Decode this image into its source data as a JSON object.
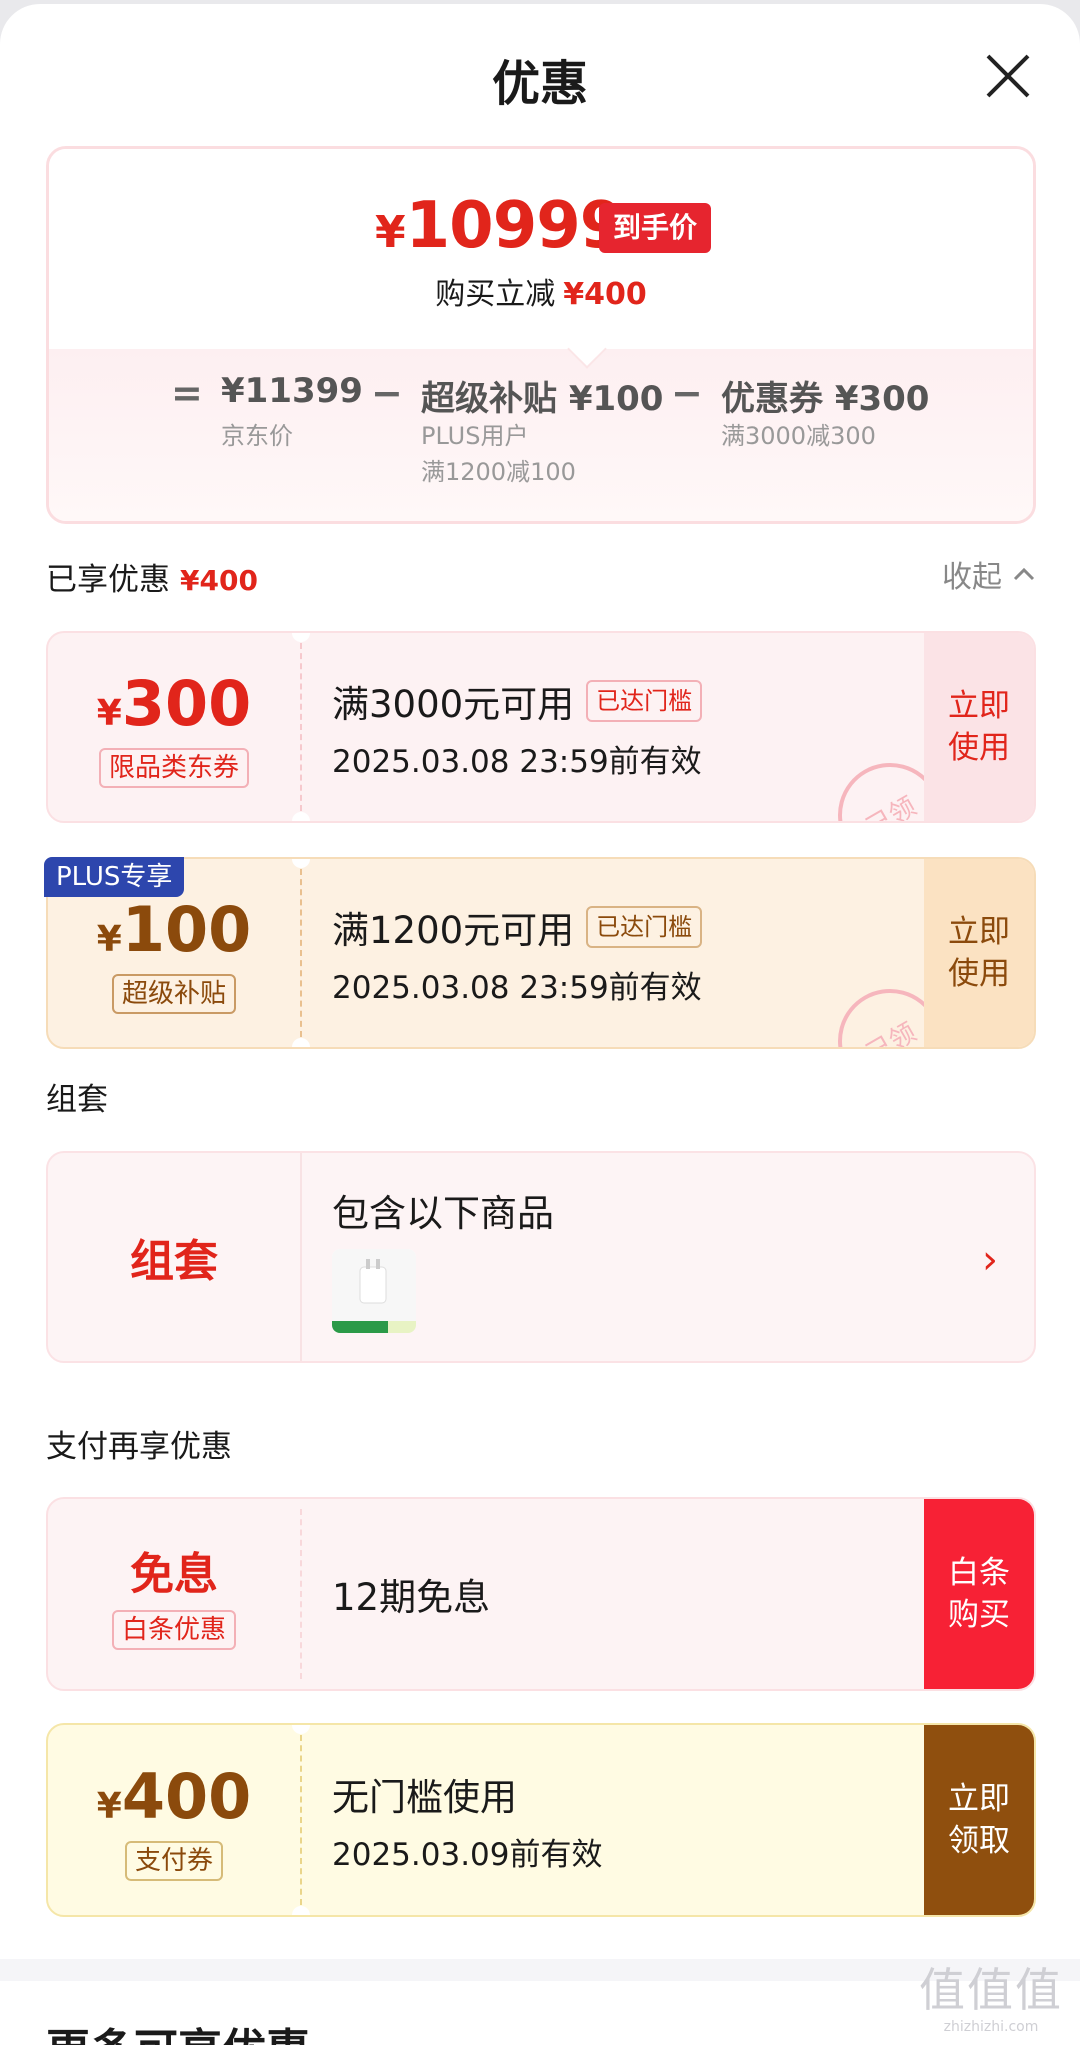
{
  "header": {
    "title": "优惠"
  },
  "summary": {
    "currency": "¥",
    "final_price": "10999",
    "badge": "到手价",
    "reduce_label": "购买立减",
    "reduce_amount": "¥400",
    "calc": {
      "eq": "=",
      "minus": "−",
      "base_price": "¥11399",
      "base_label": "京东价",
      "subsidy_title": "超级补贴 ¥100",
      "subsidy_line1": "PLUS用户",
      "subsidy_line2": "满1200减100",
      "coupon_title": "优惠券 ¥300",
      "coupon_line1": "满3000减300"
    }
  },
  "enjoyed": {
    "label": "已享优惠",
    "amount": "¥400",
    "collapse": "收起"
  },
  "coupons": [
    {
      "currency": "¥",
      "value": "300",
      "tag": "限品类东券",
      "condition": "满3000元可用",
      "reached": "已达门槛",
      "expiry": "2025.03.08 23:59前有效",
      "action_1": "立即",
      "action_2": "使用",
      "stamp": "已领"
    },
    {
      "badge": "PLUS专享",
      "currency": "¥",
      "value": "100",
      "tag": "超级补贴",
      "condition": "满1200元可用",
      "reached": "已达门槛",
      "expiry": "2025.03.08 23:59前有效",
      "action_1": "立即",
      "action_2": "使用",
      "stamp": "已领"
    }
  ],
  "bundle_section": {
    "title": "组套",
    "card_label": "组套",
    "card_title": "包含以下商品",
    "arrow": "›"
  },
  "pay_section": {
    "title": "支付再享优惠",
    "baitiao": {
      "main": "免息",
      "tag": "白条优惠",
      "desc": "12期免息",
      "action_1": "白条",
      "action_2": "购买"
    },
    "pay_coupon": {
      "currency": "¥",
      "value": "400",
      "tag": "支付券",
      "condition": "无门槛使用",
      "expiry": "2025.03.09前有效",
      "action_1": "立即",
      "action_2": "领取"
    }
  },
  "more": {
    "title": "更多可享优惠"
  },
  "watermark": {
    "mark": "值值值",
    "url": "zhizhizhi.com"
  },
  "colors": {
    "accent": "#e1251b",
    "gold": "#8b4a0c",
    "plus_blue": "#2d46ad",
    "baitiao_red": "#f72135"
  },
  "icons": {
    "close": "close-icon",
    "collapse": "chevron-up-icon",
    "arrow": "chevron-right-icon"
  }
}
